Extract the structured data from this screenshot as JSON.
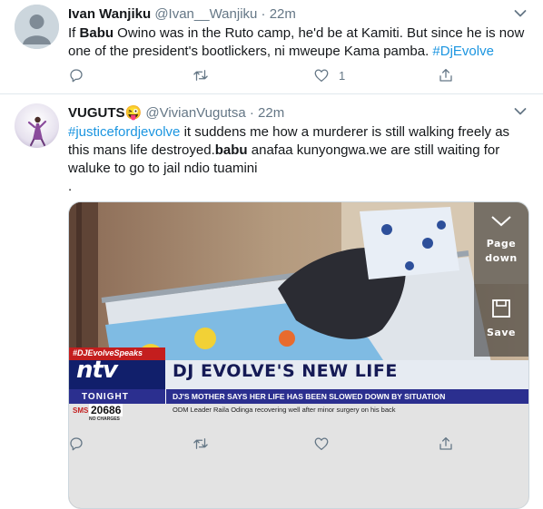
{
  "tweets": [
    {
      "name": "Ivan Wanjiku",
      "handle": "@Ivan__Wanjiku",
      "separator": "·",
      "time": "22m",
      "text": {
        "p1": "If ",
        "bold1": "Babu",
        "p2": " Owino was in the Ruto camp, he'd be at Kamiti. But since he is now one of the president's bootlickers, ni mweupe Kama pamba. ",
        "hashtag": "#DjEvolve"
      },
      "like_count": "1"
    },
    {
      "name": "VUGUTS",
      "name_emoji": "😜",
      "handle": "@VivianVugutsa",
      "separator": "·",
      "time": "22m",
      "text": {
        "hashtag": "#justicefordjevolve",
        "p1": "  it suddens me how a murderer is still walking freely as this mans life destroyed.",
        "bold1": "babu",
        "p2": " anafaa kunyongwa.we are still waiting for waluke to go to jail ndio tuamini",
        "p3": "."
      },
      "media": {
        "page_down": [
          "Page",
          "down"
        ],
        "save": "Save",
        "tag": "#DJEvolveSpeaks",
        "logo": "ntv",
        "logo_sub": "TONIGHT",
        "headline": "DJ EVOLVE'S NEW LIFE",
        "subheadline": "DJ'S MOTHER SAYS HER LIFE HAS BEEN SLOWED DOWN BY SITUATION",
        "sms_label": "SMS",
        "sms_number": "20686",
        "sms_note": "NO CHARGES",
        "ticker": "ODM Leader Raila Odinga recovering well after minor surgery on his back"
      }
    }
  ],
  "colors": {
    "link": "#1b95e0",
    "secondary": "#657786",
    "divider": "#e1e8ed"
  },
  "icons": [
    "reply-icon",
    "retweet-icon",
    "like-icon",
    "share-icon",
    "chevron-down-icon",
    "save-icon"
  ]
}
